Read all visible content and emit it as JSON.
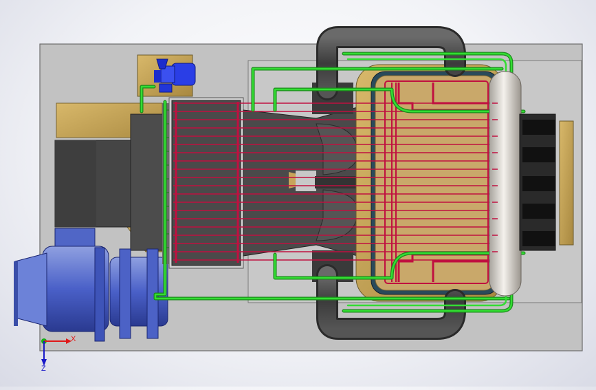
{
  "viewport": {
    "background_top": "#ffffff",
    "background_edge": "#d9dbe6"
  },
  "colors": {
    "base_plate": "#c2c2c2",
    "casing_dark": "#4a4a4a",
    "casing_mid": "#5a5a5a",
    "insulation_tan": "#c8a45a",
    "water_pipe_green": "#22c022",
    "tube_red": "#c01040",
    "flue_pipe_dark": "#3a3a3a",
    "drum_light": "#e6e2dc",
    "pump_blue": "#2e3ee0",
    "fan_blue": "#5a72cc",
    "axis_x": "#e01818",
    "axis_z": "#1818c8",
    "axis_y": "#18b018"
  },
  "components": [
    {
      "name": "base-plate"
    },
    {
      "name": "feed-water-pump",
      "icon": "pump-icon"
    },
    {
      "name": "blower-fan",
      "icon": "fan-icon"
    },
    {
      "name": "fan-motor",
      "icon": "motor-icon"
    },
    {
      "name": "economizer-casing"
    },
    {
      "name": "flue-gas-duct"
    },
    {
      "name": "furnace-tube-bank"
    },
    {
      "name": "steam-drum"
    },
    {
      "name": "flue-pipe"
    },
    {
      "name": "burner-housing"
    }
  ],
  "triad": {
    "x_label": "X",
    "z_label": "Z"
  }
}
